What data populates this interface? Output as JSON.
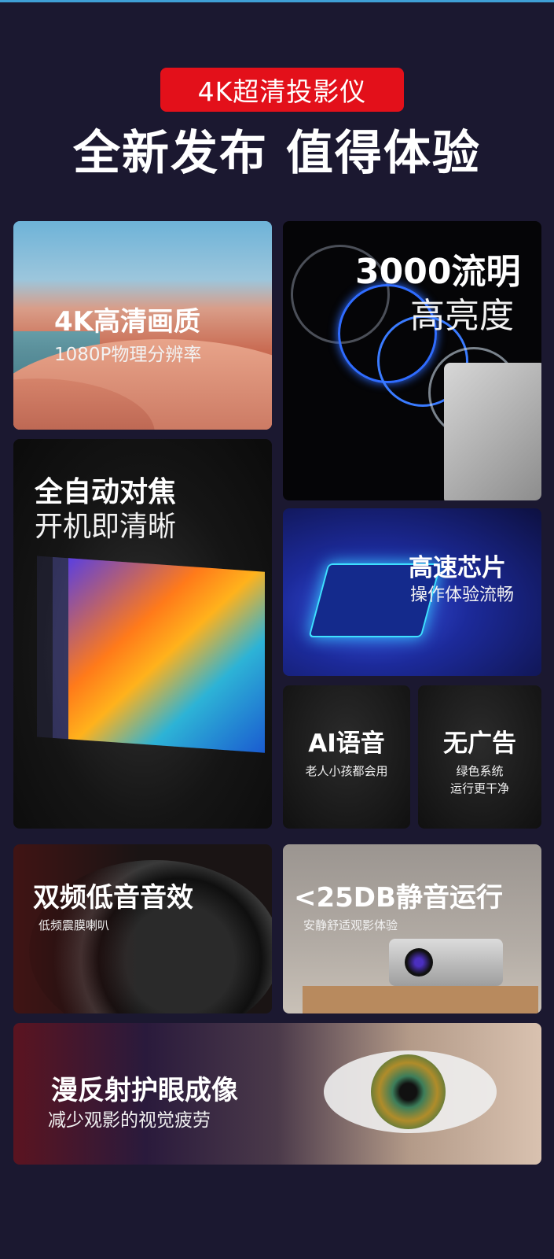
{
  "header": {
    "badge": "4K超清投影仪",
    "headline": "全新发布 值得体验"
  },
  "cards": {
    "resolution": {
      "title": "4K高清画质",
      "subtitle": "1080P物理分辨率"
    },
    "brightness": {
      "title": "3000流明",
      "subtitle": "高亮度"
    },
    "autofocus": {
      "title": "全自动对焦",
      "subtitle": "开机即清晰"
    },
    "chip": {
      "title": "高速芯片",
      "subtitle": "操作体验流畅"
    },
    "voice": {
      "title": "AI语音",
      "subtitle": "老人小孩都会用"
    },
    "noads": {
      "title": "无广告",
      "subtitle_line1": "绿色系统",
      "subtitle_line2": "运行更干净"
    },
    "audio": {
      "title": "双频低音音效",
      "subtitle": "低频震膜喇叭"
    },
    "quiet": {
      "title": "<25DB静音运行",
      "subtitle": "安静舒适观影体验"
    },
    "eyecare": {
      "title": "漫反射护眼成像",
      "subtitle": "减少观影的视觉疲劳"
    }
  },
  "colors": {
    "badge": "#e3101a",
    "background": "#1b1830"
  }
}
